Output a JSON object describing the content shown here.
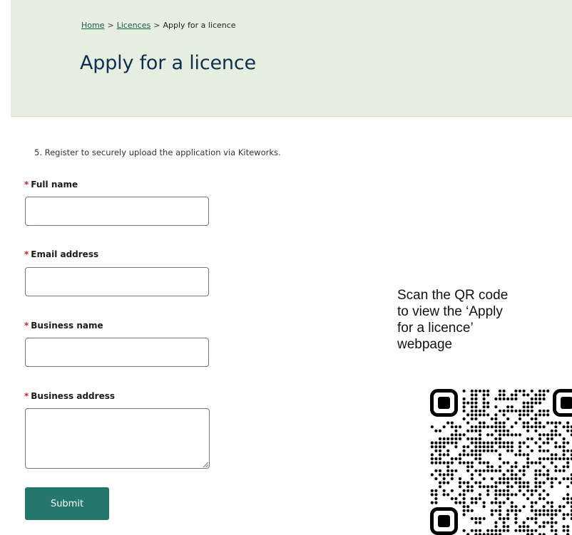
{
  "breadcrumb": {
    "home": "Home",
    "sep1": ">",
    "licences": "Licences",
    "sep2": ">",
    "current": "Apply for a licence"
  },
  "page": {
    "title": "Apply for a licence"
  },
  "form": {
    "step_text": "5. Register to securely upload the application via Kiteworks.",
    "required_marker": "*",
    "fields": [
      {
        "label": "Full name",
        "value": ""
      },
      {
        "label": "Email address",
        "value": ""
      },
      {
        "label": "Business name",
        "value": ""
      },
      {
        "label": "Business address",
        "value": ""
      }
    ],
    "submit_label": "Submit"
  },
  "qr": {
    "caption_lines": [
      "Scan the QR code",
      "to view the ‘Apply",
      "for a licence’",
      "webpage"
    ],
    "icon": "qr-code"
  },
  "colors": {
    "header_bg": "#e6eedf",
    "title": "#0d2f52",
    "link": "#1a5a52",
    "required": "#c0262e",
    "button": "#24786b"
  }
}
